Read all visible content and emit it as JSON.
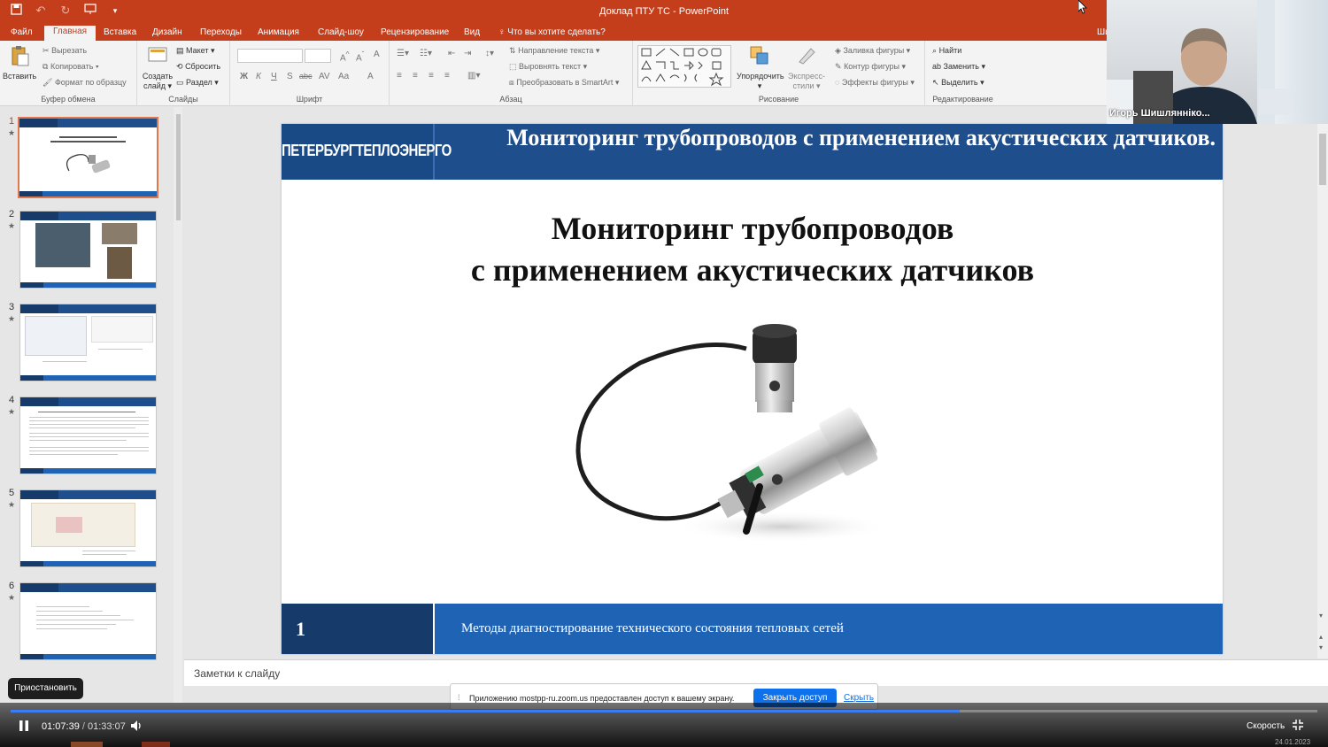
{
  "titlebar": {
    "window_title": "Доклад ПТУ ТС - PowerPoint"
  },
  "tabs": [
    "Файл",
    "Главная",
    "Вставка",
    "Дизайн",
    "Переходы",
    "Анимация",
    "Слайд-шоу",
    "Рецензирование",
    "Вид"
  ],
  "active_tab": "Главная",
  "tell_me": "Что вы хотите сделать?",
  "tab_cut_right": "Ши",
  "ribbon": {
    "clipboard": {
      "label": "Буфер обмена",
      "paste": "Вставить",
      "cut": "Вырезать",
      "copy": "Копировать",
      "format_painter": "Формат по образцу"
    },
    "slides": {
      "label": "Слайды",
      "new_slide_line1": "Создать",
      "new_slide_line2": "слайд",
      "layout": "Макет",
      "reset": "Сбросить",
      "section": "Раздел"
    },
    "font": {
      "label": "Шрифт"
    },
    "paragraph": {
      "label": "Абзац",
      "text_direction": "Направление текста",
      "align_text": "Выровнять текст",
      "smartart": "Преобразовать в SmartArt"
    },
    "drawing": {
      "label": "Рисование",
      "arrange": "Упорядочить",
      "quick_styles_line1": "Экспресс-",
      "quick_styles_line2": "стили",
      "shape_fill": "Заливка фигуры",
      "shape_outline": "Контур фигуры",
      "shape_effects": "Эффекты фигуры"
    },
    "editing": {
      "label": "Редактирование",
      "find": "Найти",
      "replace": "Заменить",
      "select": "Выделить"
    }
  },
  "thumbnails": [
    {
      "num": "1",
      "star": "★"
    },
    {
      "num": "2",
      "star": "★"
    },
    {
      "num": "3",
      "star": "★"
    },
    {
      "num": "4",
      "star": "★"
    },
    {
      "num": "5",
      "star": "★"
    },
    {
      "num": "6",
      "star": "★"
    }
  ],
  "slide": {
    "logo": "ПЕТЕРБУРГТЕПЛОЭНЕРГО",
    "header_title": "Мониторинг трубопроводов с применением акустических датчиков.",
    "title_line1": "Мониторинг трубопроводов",
    "title_line2": "с применением акустических датчиков",
    "footer_number": "1",
    "footer_text": "Методы диагностирование технического состояния тепловых сетей"
  },
  "notes_placeholder": "Заметки к слайду",
  "share_bar": {
    "message": "Приложению mostpp-ru.zoom.us предоставлен доступ к вашему экрану.",
    "stop_button": "Закрыть доступ",
    "hide_link": "Скрыть"
  },
  "webcam": {
    "name": "Игорь Шишлянніко..."
  },
  "video": {
    "tooltip": "Приостановить",
    "current_time": "01:07:39",
    "separator": "/",
    "duration": "01:33:07",
    "speed_label": "Скорость",
    "progress_fraction": 0.7266,
    "accent": "#3b7df0",
    "date": "24.01.2023"
  },
  "colors": {
    "ppt_accent": "#c43e1c",
    "slide_blue": "#1f4e8c",
    "footer_blue": "#1f63b5"
  }
}
